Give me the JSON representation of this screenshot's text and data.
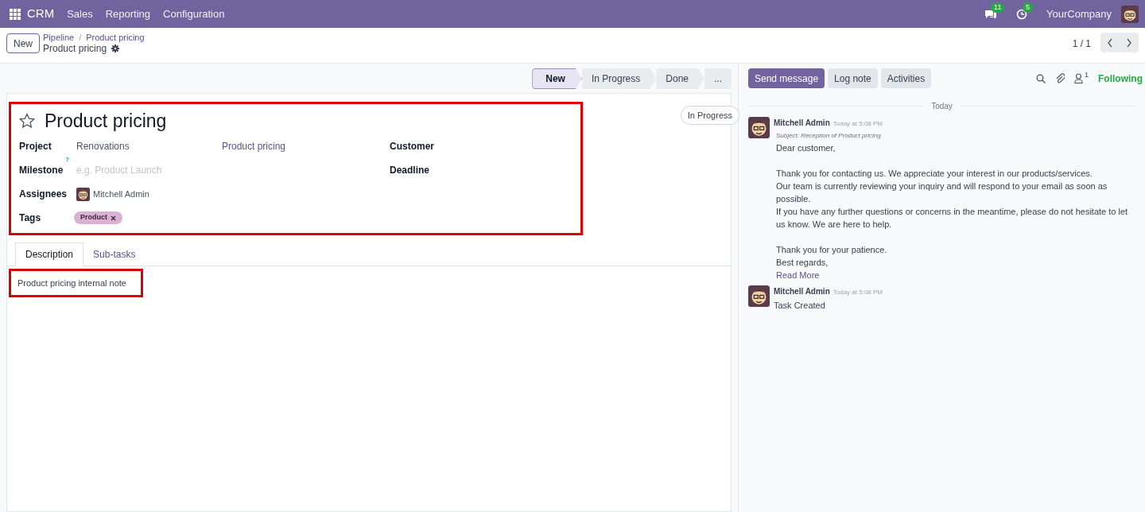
{
  "navbar": {
    "app": "CRM",
    "menus": [
      "Sales",
      "Reporting",
      "Configuration"
    ],
    "messages_count": "11",
    "activities_count": "5",
    "company": "YourCompany"
  },
  "control_panel": {
    "new_button": "New",
    "breadcrumb": [
      "Pipeline",
      "Product pricing"
    ],
    "breadcrumb_separator": "/",
    "record_title": "Product pricing",
    "pager": "1 / 1"
  },
  "stages": [
    {
      "label": "New",
      "selected": true
    },
    {
      "label": "In Progress",
      "selected": false
    },
    {
      "label": "Done",
      "selected": false
    },
    {
      "label": "...",
      "selected": false
    }
  ],
  "form": {
    "highlighted": true,
    "starred": false,
    "title": "Product pricing",
    "state_button": "In Progress",
    "left_fields": [
      {
        "kind": "text",
        "label": "Project",
        "value": "Renovations",
        "extra": "Product pricing"
      },
      {
        "kind": "placeholder",
        "label": "Milestone",
        "help": "?",
        "placeholder": "e.g. Product Launch"
      },
      {
        "kind": "user",
        "label": "Assignees",
        "value": "Mitchell Admin"
      },
      {
        "kind": "tag",
        "label": "Tags",
        "value": "Product"
      }
    ],
    "right_fields": [
      {
        "label": "Customer"
      },
      {
        "label": "Deadline"
      }
    ]
  },
  "tabs": [
    {
      "label": "Description",
      "selected": true
    },
    {
      "label": "Sub-tasks",
      "selected": false
    }
  ],
  "description": {
    "highlighted": true,
    "text": "Product pricing internal note"
  },
  "chatter": {
    "buttons": [
      {
        "label": "Send message",
        "primary": true
      },
      {
        "label": "Log note",
        "primary": false
      },
      {
        "label": "Activities",
        "primary": false
      }
    ],
    "followers_count": "1",
    "follow_label": "Following",
    "date_separator": "Today",
    "messages": [
      {
        "author": "Mitchell Admin",
        "time": "Today at 5:08 PM",
        "subject": "Subject: Reception of Product pricing",
        "paragraphs": [
          [
            "Dear customer,"
          ],
          [
            "Thank you for contacting us. We appreciate your interest in our products/services.",
            "Our team is currently reviewing your inquiry and will respond to your email as soon as possible.",
            "If you have any further questions or concerns in the meantime, please do not hesitate to let us know. We are here to help."
          ],
          [
            "Thank you for your patience.",
            "Best regards,"
          ]
        ],
        "read_more": "Read More"
      },
      {
        "author": "Mitchell Admin",
        "time": "Today at 5:08 PM",
        "paragraphs": [
          [
            "Task Created"
          ]
        ]
      }
    ]
  }
}
